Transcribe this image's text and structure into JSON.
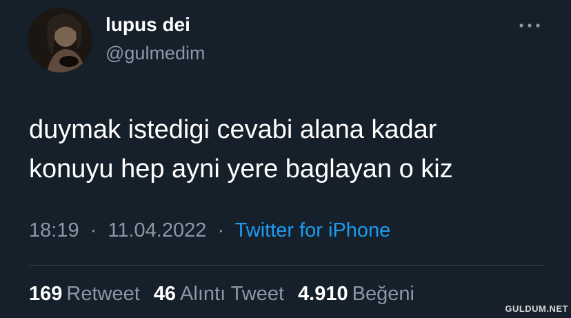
{
  "user": {
    "display_name": "lupus dei",
    "handle": "@gulmedim",
    "avatar_icon": "profile-photo"
  },
  "tweet": {
    "lines": [
      "duymak istedigi cevabi alana kadar",
      "konuyu hep ayni yere baglayan o kiz"
    ],
    "time": "18:19",
    "date": "11.04.2022",
    "separator": "·",
    "source": "Twitter for iPhone"
  },
  "stats": {
    "retweets": {
      "value": "169",
      "label": "Retweet"
    },
    "quotes": {
      "value": "46",
      "label": "Alıntı Tweet"
    },
    "likes": {
      "value": "4.910",
      "label": "Beğeni"
    }
  },
  "watermark": "GULDUM.NET",
  "colors": {
    "background": "#15202b",
    "secondary_text": "#8b98a5",
    "accent": "#1d9bf0",
    "divider": "#38444d"
  }
}
